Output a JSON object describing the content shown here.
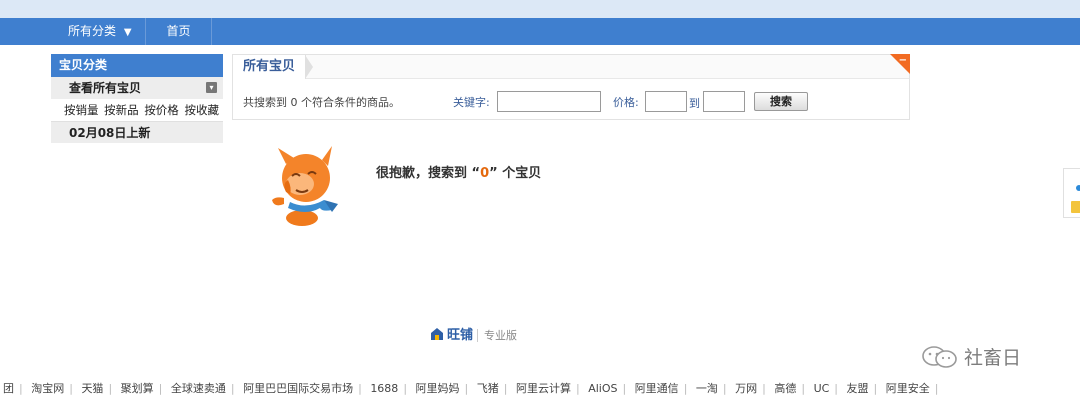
{
  "nav": {
    "category_label": "所有分类",
    "category_arrow": "▼",
    "home_label": "首页"
  },
  "sidebar": {
    "title": "宝贝分类",
    "view_all": "查看所有宝贝",
    "sort_options": [
      "按销量",
      "按新品",
      "按价格",
      "按收藏"
    ],
    "new_arrivals": "02月08日上新"
  },
  "main": {
    "tab_title": "所有宝贝",
    "result_text": "共搜索到 0 个符合条件的商品。",
    "keyword_label": "关键字:",
    "keyword_value": "",
    "price_label": "价格:",
    "price_from_value": "",
    "price_to_label": "到",
    "price_to_value": "",
    "search_button": "搜索"
  },
  "empty_state": {
    "prefix": "很抱歉，搜索到 “",
    "count": "0",
    "suffix": "” 个宝贝"
  },
  "brand": {
    "name": "旺铺",
    "edition": "专业版"
  },
  "watermark": {
    "text": "社畜日"
  },
  "footer": {
    "links": [
      "团",
      "淘宝网",
      "天猫",
      "聚划算",
      "全球速卖通",
      "阿里巴巴国际交易市场",
      "1688",
      "阿里妈妈",
      "飞猪",
      "阿里云计算",
      "AliOS",
      "阿里通信",
      "一淘",
      "万网",
      "高德",
      "UC",
      "友盟",
      "阿里安全",
      ""
    ]
  },
  "colors": {
    "nav_blue": "#3f7fcf",
    "accent_orange": "#e4690e",
    "corner_orange": "#f26b22"
  }
}
